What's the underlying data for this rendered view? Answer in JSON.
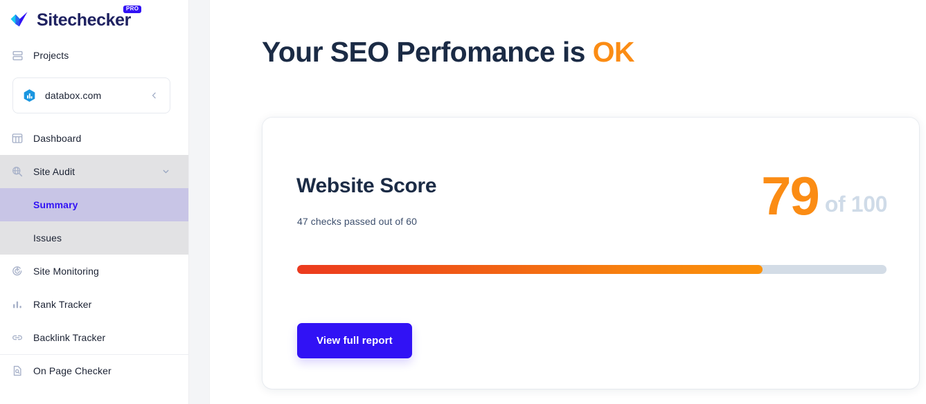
{
  "brand": {
    "name": "Sitechecker",
    "badge": "PRO",
    "logo_icon": "checkmark-logo-icon",
    "text_color": "#1f2261",
    "badge_color": "#3112f5"
  },
  "sidebar": {
    "projects_label": "Projects",
    "projects_icon": "projects-icon",
    "project": {
      "name": "databox.com",
      "icon": "databox-hexagon-icon",
      "collapse_icon": "chevron-left-icon"
    },
    "items": [
      {
        "label": "Dashboard",
        "icon": "dashboard-grid-icon",
        "state": "default"
      },
      {
        "label": "Site Audit",
        "icon": "site-audit-magnifier-icon",
        "state": "expanded",
        "chevron": "chevron-down-icon"
      },
      {
        "label": "Summary",
        "icon": "",
        "state": "active-sub"
      },
      {
        "label": "Issues",
        "icon": "",
        "state": "sub"
      },
      {
        "label": "Site Monitoring",
        "icon": "site-monitoring-pulse-icon",
        "state": "default"
      },
      {
        "label": "Rank Tracker",
        "icon": "rank-tracker-bars-icon",
        "state": "default"
      },
      {
        "label": "Backlink Tracker",
        "icon": "backlink-chain-icon",
        "state": "default"
      },
      {
        "label": "On Page Checker",
        "icon": "on-page-checker-doc-icon",
        "state": "default",
        "divider_above": true
      }
    ]
  },
  "main": {
    "headline_prefix": "Your SEO Perfomance is",
    "headline_status": "OK",
    "headline_status_color": "#fb8c14",
    "card": {
      "title": "Website Score",
      "subtitle": "47 checks passed out of 60",
      "score_value": "79",
      "score_of": "of 100",
      "score_color": "#fb8c14",
      "score_of_color": "#cfdbe8",
      "progress_percent": 79,
      "progress_fill_start": "#ec3a1e",
      "progress_fill_end": "#fb910b",
      "progress_track_color": "#d3dce6",
      "button_label": "View full report",
      "button_color": "#3112f5"
    }
  }
}
